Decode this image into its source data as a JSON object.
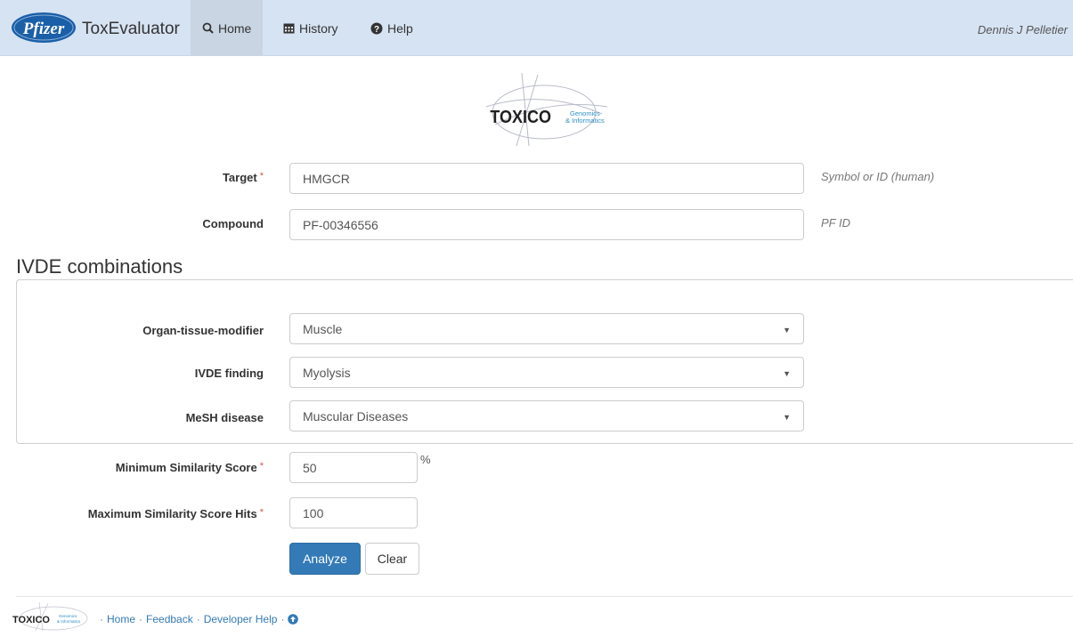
{
  "navbar": {
    "logo_text": "Pfizer",
    "brand": "ToxEvaluator",
    "items": [
      {
        "label": "Home",
        "icon": "search-icon"
      },
      {
        "label": "History",
        "icon": "calendar-icon"
      },
      {
        "label": "Help",
        "icon": "question-circle-icon"
      }
    ],
    "user": "Dennis J Pelletier"
  },
  "logo": {
    "main": "TOXICO",
    "line1": "Genomics",
    "line2": "& Informatics"
  },
  "form": {
    "target": {
      "label": "Target",
      "required": "*",
      "value": "HMGCR",
      "hint": "Symbol or ID (human)"
    },
    "compound": {
      "label": "Compound",
      "value": "PF-00346556",
      "hint": "PF ID"
    }
  },
  "ivde": {
    "title": "IVDE combinations",
    "organ": {
      "label": "Organ-tissue-modifier",
      "value": "Muscle"
    },
    "finding": {
      "label": "IVDE finding",
      "value": "Myolysis"
    },
    "mesh": {
      "label": "MeSH disease",
      "value": "Muscular Diseases"
    }
  },
  "scores": {
    "min": {
      "label": "Minimum Similarity Score",
      "required": "*",
      "value": "50",
      "unit": "%"
    },
    "max": {
      "label": "Maximum Similarity Score Hits",
      "required": "*",
      "value": "100"
    }
  },
  "buttons": {
    "analyze": "Analyze",
    "clear": "Clear"
  },
  "footer": {
    "links": [
      "Home",
      "Feedback",
      "Developer Help"
    ],
    "separator": "·",
    "icon": "arrow-up-circle-icon"
  },
  "colors": {
    "navbar_bg": "#d6e3f3",
    "primary": "#337ab7",
    "required": "#d9534f",
    "pfizer_blue": "#1a5fa8"
  }
}
